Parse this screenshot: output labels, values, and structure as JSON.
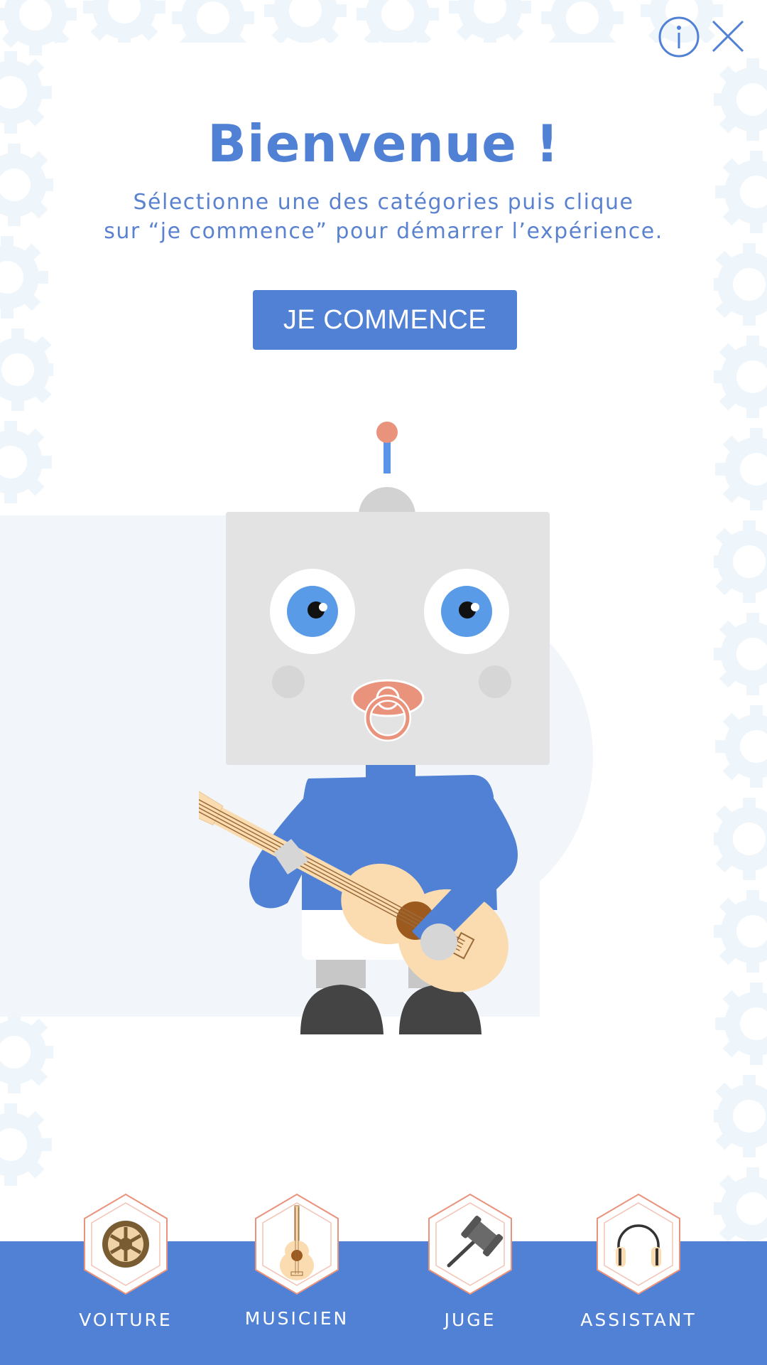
{
  "header": {
    "info_icon": "info-circle-icon",
    "close_icon": "close-icon"
  },
  "welcome": {
    "title": "Bienvenue !",
    "subtitle_line1": "Sélectionne une des catégories puis clique",
    "subtitle_line2": "sur “je commence” pour démarrer l’expérience.",
    "start_label": "JE COMMENCE"
  },
  "categories": [
    {
      "label": "VOITURE",
      "icon": "steering-wheel-icon"
    },
    {
      "label": "MUSICIEN",
      "icon": "guitar-icon"
    },
    {
      "label": "JUGE",
      "icon": "gavel-icon"
    },
    {
      "label": "ASSISTANT",
      "icon": "headphones-icon"
    }
  ],
  "colors": {
    "accent": "#5181d5",
    "robot_head": "#e3e3e3",
    "pacifier": "#e9927c",
    "guitar_body": "#fbdcb0"
  }
}
